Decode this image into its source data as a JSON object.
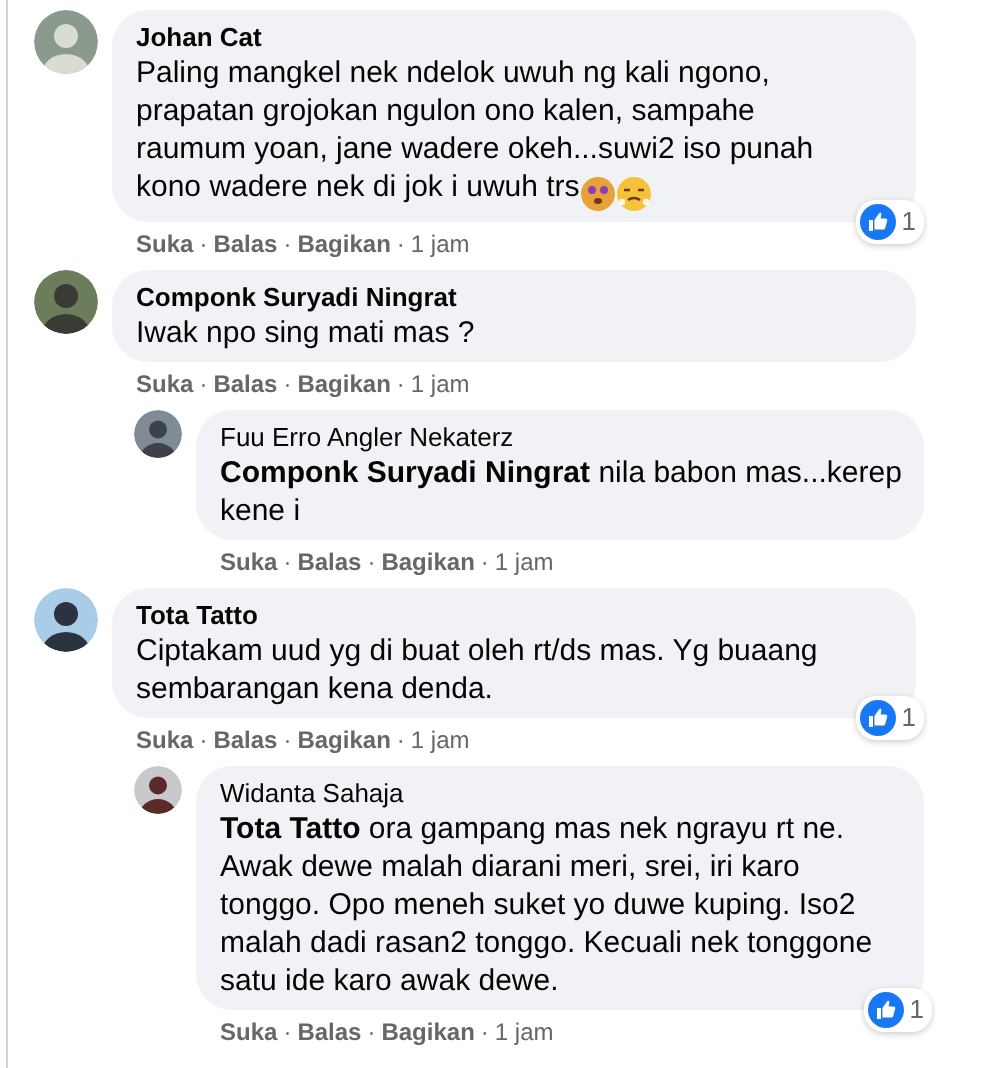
{
  "separator": "·",
  "comments": [
    {
      "author": "Johan Cat",
      "text": "Paling mangkel nek ndelok uwuh ng kali ngono, prapatan grojokan ngulon ono kalen, sampahe raumum yoan, jane wadere okeh...suwi2 iso punah kono wadere nek di jok i uwuh trs",
      "emoji_after": true,
      "reaction_count": "1",
      "actions": [
        "Suka",
        "Balas",
        "Bagikan"
      ],
      "time": "1 jam"
    },
    {
      "author": "Componk Suryadi Ningrat",
      "text": "Iwak npo sing mati mas ?",
      "actions": [
        "Suka",
        "Balas",
        "Bagikan"
      ],
      "time": "1 jam",
      "replies": [
        {
          "author": "Fuu Erro Angler Nekaterz",
          "mention": "Componk Suryadi Ningrat",
          "text": " nila babon mas...kerep kene i",
          "actions": [
            "Suka",
            "Balas",
            "Bagikan"
          ],
          "time": "1 jam"
        }
      ]
    },
    {
      "author": "Tota Tatto",
      "text": "Ciptakam uud yg di buat oleh rt/ds mas. Yg buaang sembarangan kena denda.",
      "reaction_count": "1",
      "actions": [
        "Suka",
        "Balas",
        "Bagikan"
      ],
      "time": "1 jam",
      "replies": [
        {
          "author": "Widanta Sahaja",
          "mention": "Tota Tatto",
          "text": " ora gampang mas nek ngrayu rt ne. Awak dewe malah diarani meri, srei, iri karo tonggo. Opo meneh suket yo duwe kuping. Iso2 malah dadi rasan2 tonggo. Kecuali nek tonggone satu ide karo awak dewe.",
          "reaction_count": "1",
          "actions": [
            "Suka",
            "Balas",
            "Bagikan"
          ],
          "time": "1 jam"
        }
      ]
    }
  ]
}
